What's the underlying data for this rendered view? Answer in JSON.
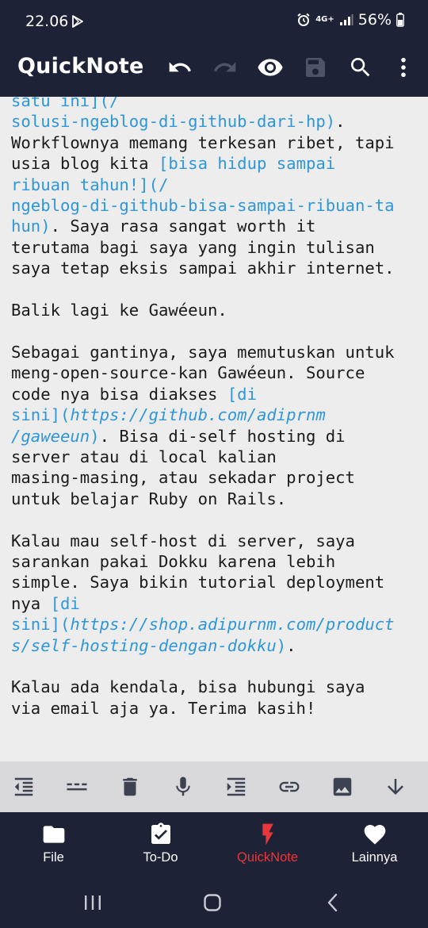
{
  "status": {
    "time": "22.06",
    "network": "4G+",
    "battery": "56%"
  },
  "app": {
    "title": "QuickNote"
  },
  "toolbar_icons": [
    "undo-icon",
    "redo-icon",
    "preview-icon",
    "save-icon",
    "search-icon",
    "more-icon"
  ],
  "editor": {
    "l1": "satu ini](/",
    "l2": "solusi-ngeblog-di-github-dari-hp)",
    "l2b": ".",
    "l3": "Workflownya memang terkesan ribet, tapi",
    "l4a": "usia blog kita ",
    "l4b": "[bisa hidup sampai",
    "l5": "ribuan tahun!](/",
    "l6": "ngeblog-di-github-bisa-sampai-ribuan-ta",
    "l7a": "hun)",
    "l7b": ". Saya rasa sangat worth it",
    "l8": "terutama bagi saya yang ingin tulisan",
    "l9": "saya tetap eksis sampai akhir internet.",
    "l11": "Balik lagi ke Gawéeun.",
    "l13": "Sebagai gantinya, saya memutuskan untuk",
    "l14": "meng-open-source-kan Gawéeun. Source",
    "l15a": "code nya bisa diakses ",
    "l15b": "[di",
    "l16a": "sini](",
    "l16b": "https://github.com/adiprnm",
    "l17a": "/gaweeun",
    "l17b": ")",
    "l17c": ". Bisa di-self hosting di",
    "l18": "server atau di local kalian",
    "l19": "masing-masing, atau sekadar project",
    "l20": "untuk belajar Ruby on Rails.",
    "l22": "Kalau mau self-host di server, saya",
    "l23": "sarankan pakai Dokku karena lebih",
    "l24": "simple. Saya bikin tutorial deployment",
    "l25a": "nya ",
    "l25b": "[di",
    "l26a": "sini](",
    "l26b": "https://shop.adipurnm.com/product",
    "l27a": "s/self-hosting-dengan-dokku",
    "l27b": ")",
    "l27c": ".",
    "l29": "Kalau ada kendala, bisa hubungi saya",
    "l30": "via email aja ya. Terima kasih!"
  },
  "format_icons": [
    "outdent-icon",
    "horizontal-rule-icon",
    "delete-icon",
    "microphone-icon",
    "indent-icon",
    "link-icon",
    "image-icon",
    "arrow-down-icon"
  ],
  "nav": {
    "file": "File",
    "todo": "To-Do",
    "quicknote": "QuickNote",
    "more": "Lainnya"
  },
  "colors": {
    "bar": "#1d2236",
    "link": "#2f97d8",
    "active": "#e9363b",
    "editor_bg": "#ededee",
    "format_bar": "#d9d9db"
  }
}
